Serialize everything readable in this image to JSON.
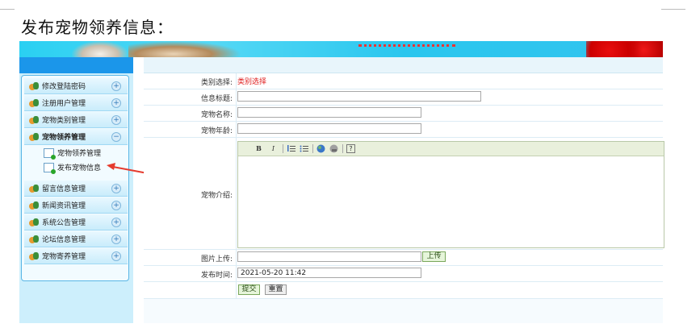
{
  "doc_title": "发布宠物领养信息：",
  "sidebar": {
    "menu": [
      {
        "label": "修改登陆密码",
        "toggle": "+"
      },
      {
        "label": "注册用户管理",
        "toggle": "+"
      },
      {
        "label": "宠物类别管理",
        "toggle": "+"
      },
      {
        "label": "宠物领养管理",
        "toggle": "−"
      },
      {
        "label": "留言信息管理",
        "toggle": "+"
      },
      {
        "label": "新闻资讯管理",
        "toggle": "+"
      },
      {
        "label": "系统公告管理",
        "toggle": "+"
      },
      {
        "label": "论坛信息管理",
        "toggle": "+"
      },
      {
        "label": "宠物寄养管理",
        "toggle": "+"
      }
    ],
    "submenu": [
      {
        "label": "宠物领养管理"
      },
      {
        "label": "发布宠物信息"
      }
    ]
  },
  "form": {
    "category_label": "类别选择:",
    "category_value": "类别选择",
    "title_label": "信息标题:",
    "name_label": "宠物名称:",
    "age_label": "宠物年龄:",
    "intro_label": "宠物介绍:",
    "image_label": "图片上传:",
    "upload_button": "上传",
    "time_label": "发布时间:",
    "time_value": "2021-05-20 11:42",
    "submit_button": "提交",
    "reset_button": "重置"
  },
  "editor_toolbar": {
    "bold": "B",
    "italic": "I",
    "help": "?"
  },
  "colors": {
    "banner": "#2ad0f2",
    "sidebar_header": "#1b96ea",
    "sidebar_bg": "#cdeffc",
    "accent_red": "#e02020",
    "button_green": "#e6f5da"
  }
}
